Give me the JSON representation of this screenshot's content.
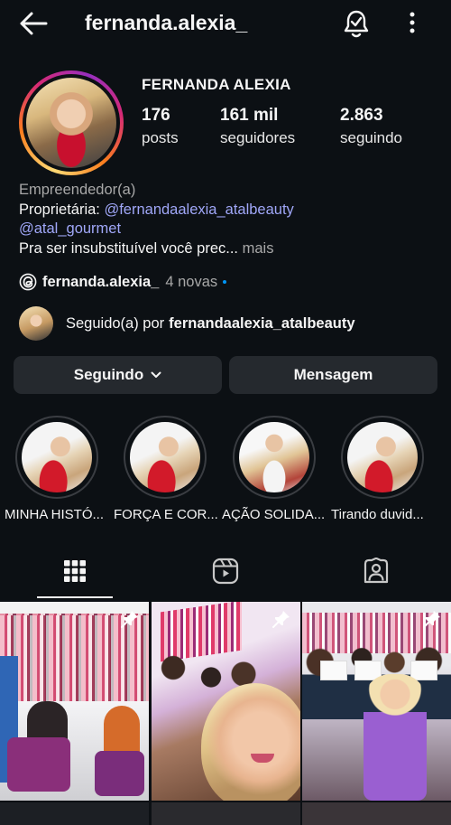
{
  "header": {
    "username": "fernanda.alexia_",
    "back_icon": "arrow-left-icon",
    "notify_icon": "bell-check-icon",
    "menu_icon": "more-vertical-icon"
  },
  "profile": {
    "full_name": "FERNANDA ALEXIA",
    "stats": [
      {
        "value": "176",
        "label": "posts"
      },
      {
        "value": "161 mil",
        "label": "seguidores"
      },
      {
        "value": "2.863",
        "label": "seguindo"
      }
    ],
    "category": "Empreendedor(a)",
    "bio_prefix": "Proprietária: ",
    "bio_link1": "@fernandaalexia_atalbeauty",
    "bio_link2": "@atal_gourmet",
    "bio_text": "Pra ser insubstituível você prec...",
    "bio_more": " mais"
  },
  "threads": {
    "name": "fernanda.alexia_",
    "new_count": "4 novas",
    "icon": "threads-icon"
  },
  "followed_by": {
    "prefix": "Seguido(a) por",
    "user": "fernandaalexia_atalbeauty"
  },
  "buttons": {
    "following": "Seguindo",
    "message": "Mensagem"
  },
  "highlights": [
    {
      "label": "MINHA HISTÓ..."
    },
    {
      "label": "FORÇA E COR..."
    },
    {
      "label": "AÇÃO SOLIDA..."
    },
    {
      "label": "Tirando duvid..."
    }
  ],
  "tabs": [
    {
      "icon": "grid-icon",
      "active": true
    },
    {
      "icon": "reels-icon",
      "active": false
    },
    {
      "icon": "tagged-icon",
      "active": false
    }
  ],
  "colors": {
    "background": "#0c1014",
    "button": "#25292e",
    "link": "#a0a7f8",
    "muted": "#a8a8a8",
    "accent_dot": "#0095f6"
  }
}
